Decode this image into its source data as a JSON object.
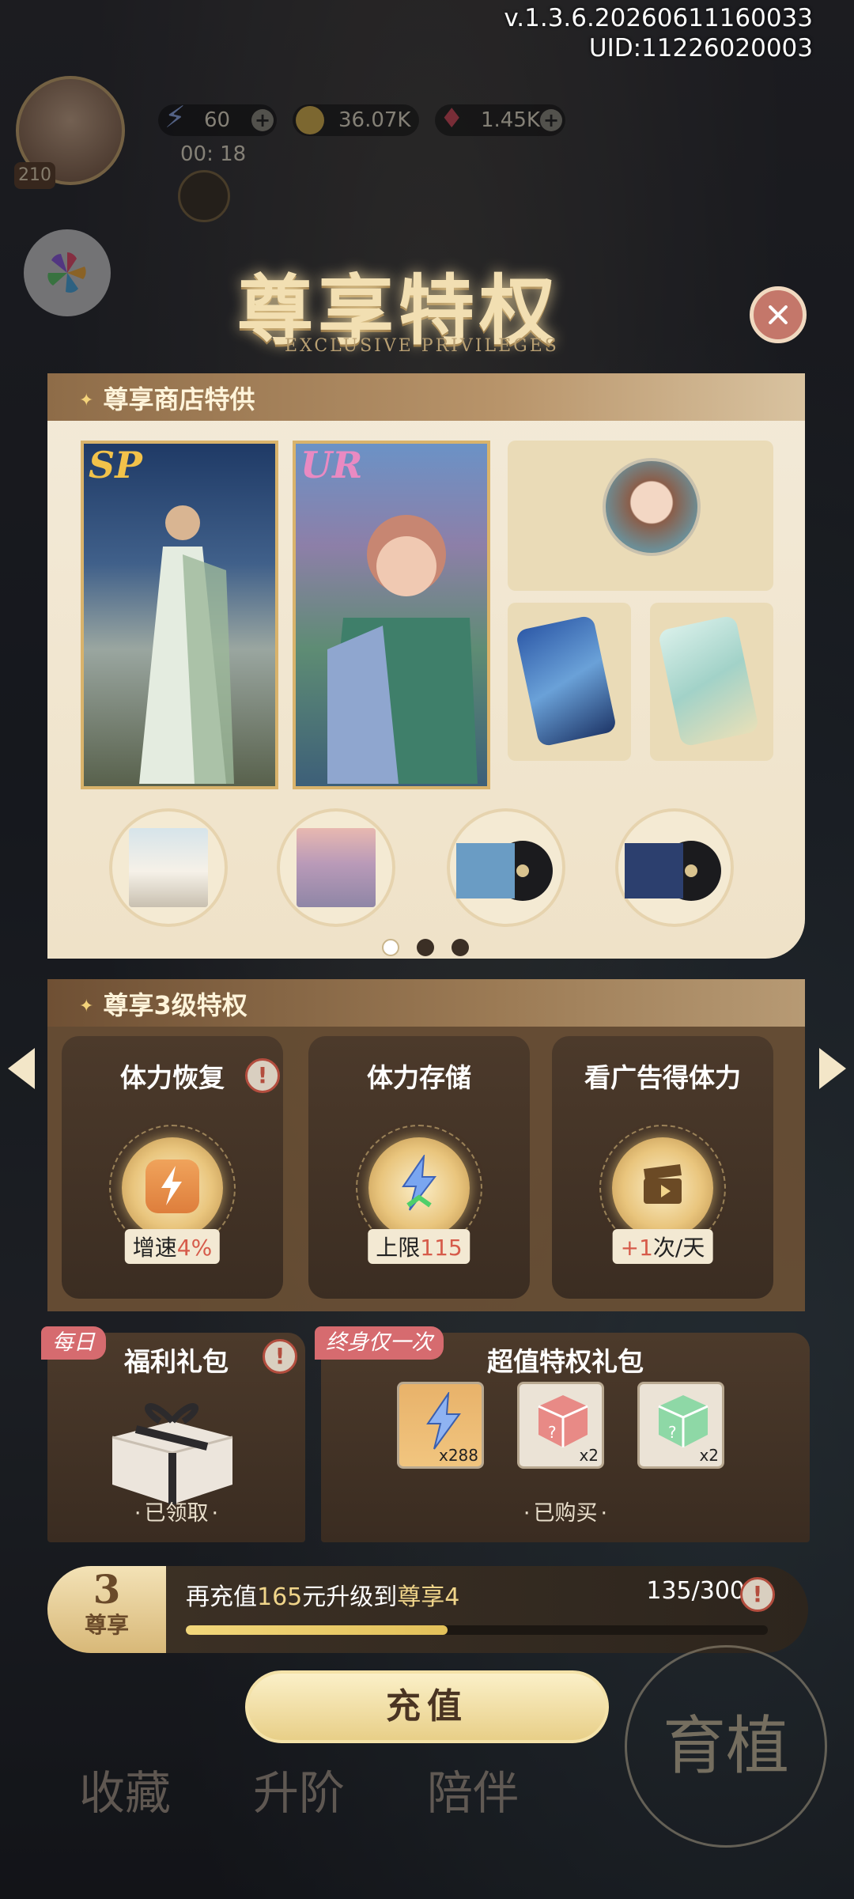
{
  "header": {
    "version": "v.1.3.6.20260611160033",
    "uid": "UID:11226020003",
    "stamina": "60",
    "timer": "00: 18",
    "gold": "36.07K",
    "gems": "1.45K",
    "player_level": "210"
  },
  "modal": {
    "title": "尊享特权",
    "subtitle": "EXCLUSIVE PRIVILEGES"
  },
  "shop": {
    "section_title": "尊享商店特供",
    "cards": [
      {
        "rarity": "SP",
        "rarity_color": "#f2c24a"
      },
      {
        "rarity": "UR",
        "rarity_color": "#e98ac2"
      }
    ],
    "page_count": 3,
    "active_page": 0
  },
  "privileges": {
    "section_title": "尊享3级特权",
    "items": [
      {
        "label": "体力恢复",
        "value_prefix": "增速",
        "value_highlight": "4%",
        "value_suffix": ""
      },
      {
        "label": "体力存储",
        "value_prefix": "上限",
        "value_highlight": "115",
        "value_suffix": ""
      },
      {
        "label": "看广告得体力",
        "value_prefix": "",
        "value_highlight": "+1",
        "value_suffix": "次/天"
      }
    ]
  },
  "daily_gift": {
    "tag": "每日",
    "title": "福利礼包",
    "status": "已领取"
  },
  "value_gift": {
    "tag": "终身仅一次",
    "title": "超值特权礼包",
    "status": "已购买",
    "rewards": [
      {
        "icon": "stamina-bolt-icon",
        "count": "x288"
      },
      {
        "icon": "red-mystery-dice-icon",
        "count": "x2"
      },
      {
        "icon": "green-mystery-dice-icon",
        "count": "x2"
      }
    ]
  },
  "progress": {
    "vip_level": "3",
    "vip_label": "尊享",
    "text_prefix": "再充值",
    "amount": "165",
    "text_middle": "元升级到",
    "next_level": "尊享4",
    "count": "135/300",
    "fraction": 0.45
  },
  "recharge_button": "充值",
  "bottom_nav": [
    "收藏",
    "升阶",
    "陪伴",
    "育植"
  ],
  "colors": {
    "accent_gold": "#e9c57d",
    "highlight_red": "#d65b4a",
    "tag_pink": "#d66b6f"
  }
}
